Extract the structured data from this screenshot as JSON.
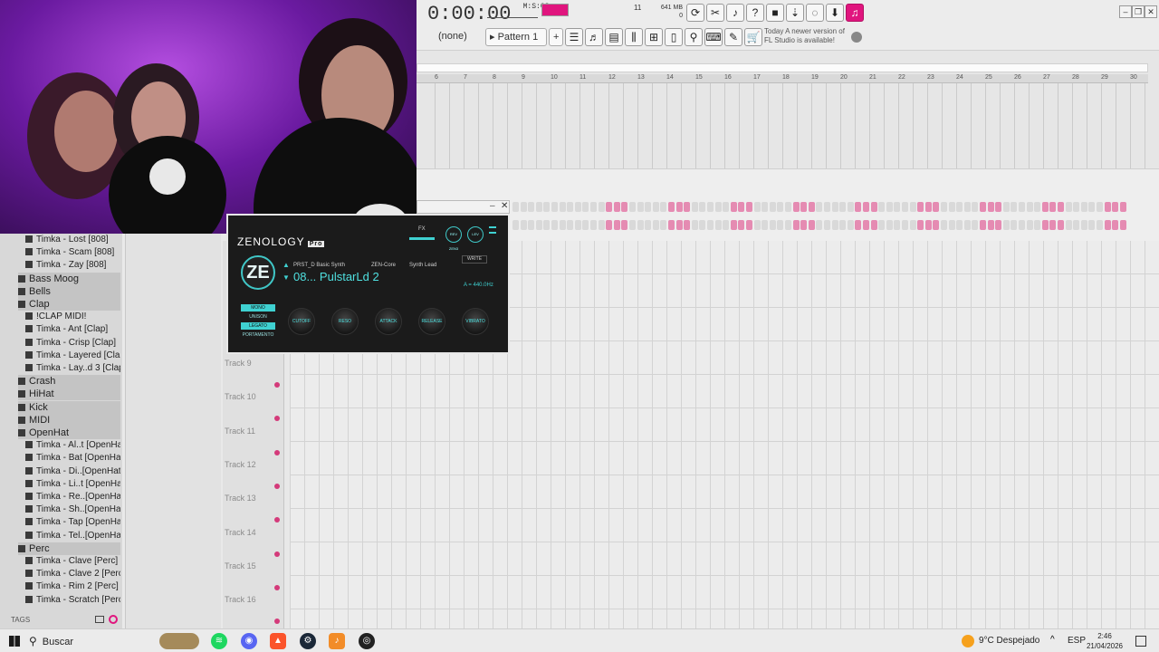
{
  "transport": {
    "time": "0:00:00",
    "time_unit": "M:S:CS",
    "cpu_value": "11",
    "memory": "641 MB",
    "polyphony": "0"
  },
  "toolbar": {
    "pattern_label": "Pattern 1",
    "channel_none": "(none)",
    "news_line1": "Today",
    "news_line2": "A newer version of",
    "news_line3": "FL Studio is available!"
  },
  "browser": {
    "items": [
      {
        "label": "Timka - Lost [808]",
        "kind": "file"
      },
      {
        "label": "Timka - Scam [808]",
        "kind": "file"
      },
      {
        "label": "Timka - Zay [808]",
        "kind": "file"
      },
      {
        "label": "Bass Moog",
        "kind": "folder"
      },
      {
        "label": "Bells",
        "kind": "folder"
      },
      {
        "label": "Clap",
        "kind": "folder"
      },
      {
        "label": "!CLAP MIDI!",
        "kind": "file"
      },
      {
        "label": "Timka - Ant [Clap]",
        "kind": "file"
      },
      {
        "label": "Timka - Crisp [Clap]",
        "kind": "file"
      },
      {
        "label": "Timka - Layered [Clap]",
        "kind": "file"
      },
      {
        "label": "Timka - Lay..d 3 [Clap]",
        "kind": "file"
      },
      {
        "label": "Crash",
        "kind": "folder"
      },
      {
        "label": "HiHat",
        "kind": "folder"
      },
      {
        "label": "Kick",
        "kind": "folder"
      },
      {
        "label": "MIDI",
        "kind": "folder"
      },
      {
        "label": "OpenHat",
        "kind": "folder"
      },
      {
        "label": "Timka - Al..t [OpenHat]",
        "kind": "file"
      },
      {
        "label": "Timka - Bat [OpenHat]",
        "kind": "file"
      },
      {
        "label": "Timka - Di..[OpenHat]",
        "kind": "file"
      },
      {
        "label": "Timka - Li..t [OpenHat]",
        "kind": "file"
      },
      {
        "label": "Timka - Re..[OpenHat]",
        "kind": "file"
      },
      {
        "label": "Timka - Sh..[OpenHat]",
        "kind": "file"
      },
      {
        "label": "Timka - Tap [OpenHat]",
        "kind": "file"
      },
      {
        "label": "Timka - Tel..[OpenHat]",
        "kind": "file"
      },
      {
        "label": "Perc",
        "kind": "folder"
      },
      {
        "label": "Timka - Clave [Perc]",
        "kind": "file"
      },
      {
        "label": "Timka - Clave 2 [Perc]",
        "kind": "file"
      },
      {
        "label": "Timka - Rim 2 [Perc]",
        "kind": "file"
      },
      {
        "label": "Timka - Scratch [Perc]",
        "kind": "file"
      }
    ],
    "tags_label": "TAGS"
  },
  "tracks": [
    "Track 9",
    "Track 10",
    "Track 11",
    "Track 12",
    "Track 13",
    "Track 14",
    "Track 15",
    "Track 16"
  ],
  "ruler_numbers": [
    "6",
    "7",
    "8",
    "9",
    "10",
    "11",
    "12",
    "13",
    "14",
    "15",
    "16",
    "17",
    "18",
    "19",
    "20",
    "21",
    "22",
    "23",
    "24",
    "25",
    "26",
    "27",
    "28",
    "29",
    "30"
  ],
  "zenology": {
    "logo": "ZENOLOGY",
    "pro": "Pro",
    "badge": "ZE",
    "category": "PRST_D Basic Synth",
    "engine": "ZEN-Core",
    "type": "Synth Lead",
    "patch_number": "08...",
    "patch_name": "PulstarLd 2",
    "write": "WRITE",
    "tuning": "A = 440.0Hz",
    "fx": "FX",
    "rev": "REV ZEN3",
    "lev": "LEV",
    "modes": [
      "MONO",
      "UNISON",
      "LEGATO",
      "PORTAMENTO"
    ],
    "active_modes": [
      "MONO",
      "LEGATO"
    ],
    "knobs": [
      "CUTOFF",
      "RESO",
      "ATTACK",
      "RELEASE",
      "VIBRATO"
    ]
  },
  "taskbar": {
    "search": "Buscar",
    "weather": "9°C Despejado",
    "lang": "ESP",
    "time": "2:46",
    "date": "21/04/2026"
  },
  "colors": {
    "accent_pink": "#e0157e",
    "step_on": "#e58bb2",
    "step_off": "#d9d9d9",
    "zen_cyan": "#40c7c7"
  }
}
